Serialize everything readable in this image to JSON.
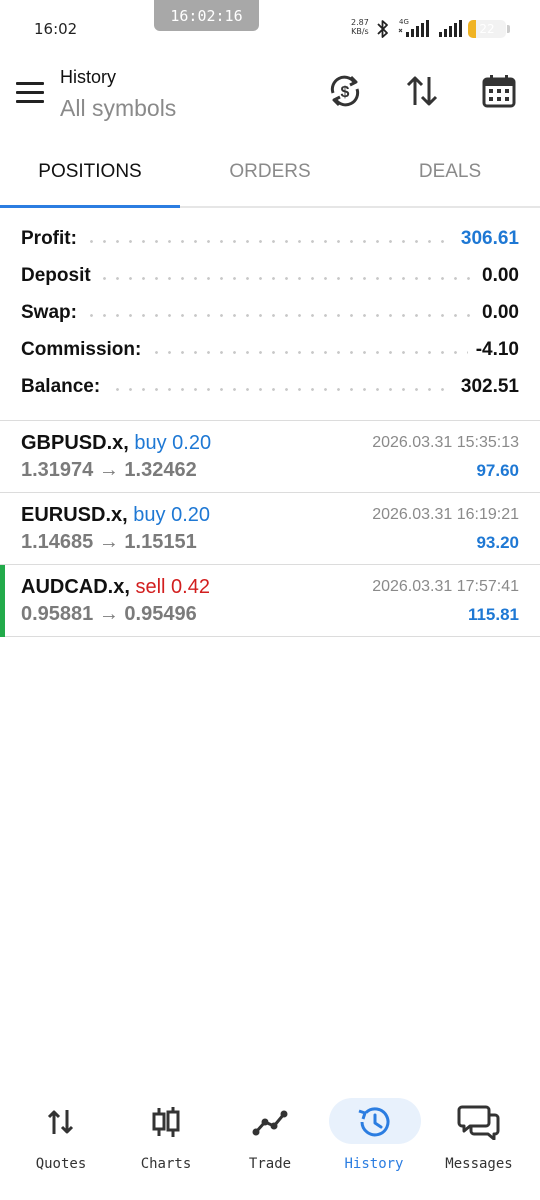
{
  "status_bar": {
    "time": "16:02",
    "clock": "16:02:16",
    "rate_value": "2.87",
    "rate_unit": "KB/s",
    "network": "4G",
    "battery": "22",
    "battery_level": 0.22,
    "battery_color": "#f0b323"
  },
  "header": {
    "title": "History",
    "subtitle": "All symbols",
    "actions": [
      "currency-exchange-icon",
      "sort-icon",
      "calendar-icon"
    ]
  },
  "tabs": [
    {
      "label": "POSITIONS",
      "active": true
    },
    {
      "label": "ORDERS",
      "active": false
    },
    {
      "label": "DEALS",
      "active": false
    }
  ],
  "summary": [
    {
      "label": "Profit:",
      "value": "306.61",
      "highlight": true
    },
    {
      "label": "Deposit",
      "value": "0.00",
      "highlight": false
    },
    {
      "label": "Swap:",
      "value": "0.00",
      "highlight": false
    },
    {
      "label": "Commission:",
      "value": "-4.10",
      "highlight": false
    },
    {
      "label": "Balance:",
      "value": "302.51",
      "highlight": false
    }
  ],
  "positions": [
    {
      "symbol": "GBPUSD.x,",
      "side": "buy 0.20",
      "side_type": "buy",
      "open_price": "1.31974",
      "arrow": "→",
      "close_price": "1.32462",
      "time": "2026.03.31 15:35:13",
      "profit": "97.60"
    },
    {
      "symbol": "EURUSD.x,",
      "side": "buy 0.20",
      "side_type": "buy",
      "open_price": "1.14685",
      "arrow": "→",
      "close_price": "1.15151",
      "time": "2026.03.31 16:19:21",
      "profit": "93.20"
    },
    {
      "symbol": "AUDCAD.x,",
      "side": "sell 0.42",
      "side_type": "sell",
      "open_price": "0.95881",
      "arrow": "→",
      "close_price": "0.95496",
      "time": "2026.03.31 17:57:41",
      "profit": "115.81",
      "selected": true
    }
  ],
  "bottom_nav": [
    {
      "label": "Quotes",
      "icon": "quotes-arrows-icon",
      "active": false
    },
    {
      "label": "Charts",
      "icon": "candlestick-chart-icon",
      "active": false
    },
    {
      "label": "Trade",
      "icon": "trade-line-icon",
      "active": false
    },
    {
      "label": "History",
      "icon": "history-clock-icon",
      "active": true
    },
    {
      "label": "Messages",
      "icon": "messages-icon",
      "active": false
    }
  ],
  "colors": {
    "accent": "#2b7de1",
    "profit_blue": "#1e78d4",
    "sell_red": "#d21f1f",
    "selected_bar": "#22aa4a"
  }
}
